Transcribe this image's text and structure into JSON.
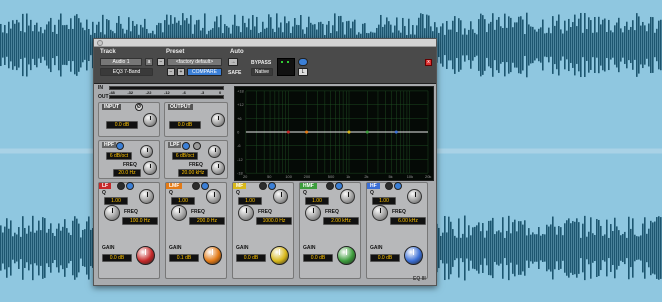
{
  "header": {
    "track_label": "Track",
    "preset_label": "Preset",
    "auto_label": "Auto",
    "track_name": "Audio 1",
    "track_channel": "a",
    "plugin_name": "EQ3 7-Band",
    "preset_name": "<factory default>",
    "compare_label": "COMPARE",
    "bypass_label": "BYPASS",
    "safe_label": "SAFE",
    "native_label": "Native",
    "auto_btn_label": "→",
    "minus_label": "−",
    "plus_label": "+",
    "link_label": "L",
    "close_label": "x"
  },
  "meters": {
    "in_label": "IN",
    "out_label": "OUT",
    "scale": [
      "-48",
      "-32",
      "-22",
      "-12",
      "-6",
      "-3",
      "0"
    ]
  },
  "io": {
    "input_label": "INPUT",
    "input_value": "0.0 dB",
    "phase_label": "Ø",
    "output_label": "OUTPUT",
    "output_value": "0.0 dB"
  },
  "filters": {
    "hpf_label": "HPF",
    "hpf_slope": "6 dB/oct",
    "hpf_freq_label": "FREQ",
    "hpf_freq": "20.0 Hz",
    "lpf_label": "LPF",
    "lpf_slope": "6 dB/oct",
    "lpf_freq_label": "FREQ",
    "lpf_freq": "20.00 kHz"
  },
  "graph": {
    "y_ticks": [
      "+18",
      "+12",
      "+6",
      "0",
      "-6",
      "-12",
      "-18"
    ],
    "x_ticks": [
      "20",
      "50",
      "100",
      "200",
      "500",
      "1k",
      "2k",
      "5k",
      "10k",
      "20k"
    ]
  },
  "bands": [
    {
      "name": "LF",
      "color": "#c62828",
      "q_label": "Q",
      "q": "1.00",
      "freq_label": "FREQ",
      "freq": "100.0 Hz",
      "gain_label": "GAIN",
      "gain": "0.0 dB"
    },
    {
      "name": "LMF",
      "color": "#e37a16",
      "q_label": "Q",
      "q": "1.00",
      "freq_label": "FREQ",
      "freq": "200.0 Hz",
      "gain_label": "GAIN",
      "gain": "0.1 dB"
    },
    {
      "name": "MF",
      "color": "#d8b81a",
      "q_label": "Q",
      "q": "1.00",
      "freq_label": "FREQ",
      "freq": "1000.0 Hz",
      "gain_label": "GAIN",
      "gain": "0.0 dB"
    },
    {
      "name": "HMF",
      "color": "#3c9d3c",
      "q_label": "Q",
      "q": "1.00",
      "freq_label": "FREQ",
      "freq": "2.00 kHz",
      "gain_label": "GAIN",
      "gain": "0.0 dB"
    },
    {
      "name": "HF",
      "color": "#3b6fd6",
      "q_label": "Q",
      "q": "1.00",
      "freq_label": "FREQ",
      "freq": "6.00 kHz",
      "gain_label": "GAIN",
      "gain": "0.0 dB"
    }
  ],
  "footer": {
    "logo": "EQ III"
  }
}
